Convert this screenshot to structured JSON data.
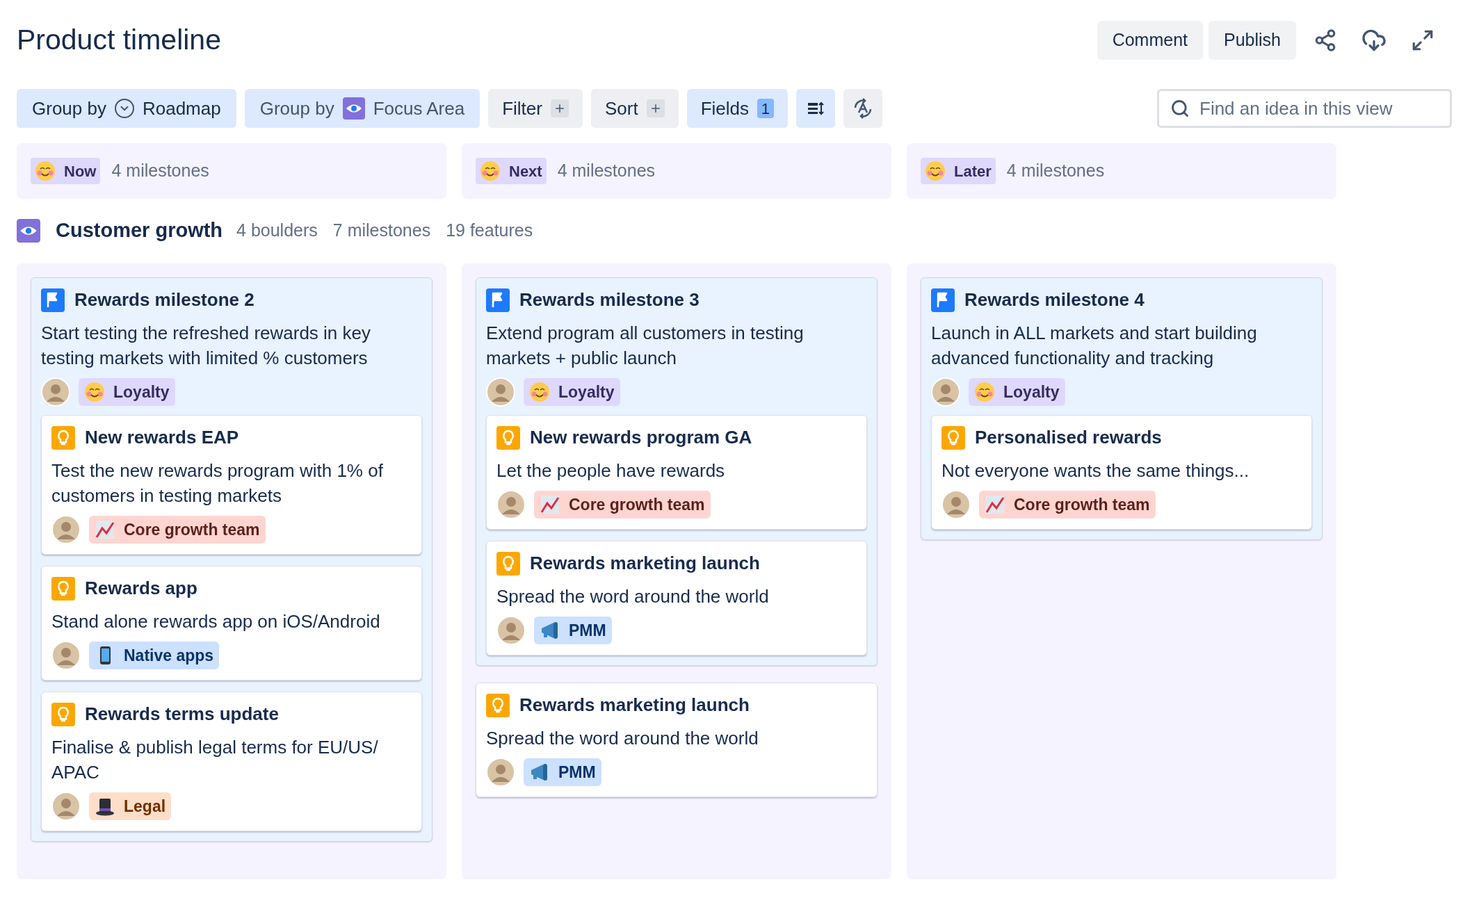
{
  "title": "Product timeline",
  "actions": [
    {
      "label": "Comment"
    },
    {
      "label": "Publish"
    }
  ],
  "toolbar": [
    {
      "kind": "grouping",
      "label": "Group by",
      "value": "Roadmap",
      "active": true
    },
    {
      "kind": "focus",
      "label": "Group by",
      "value": "Focus Area",
      "active": true
    },
    {
      "kind": "add",
      "label": "Filter",
      "active": false
    },
    {
      "kind": "add",
      "label": "Sort",
      "active": false
    },
    {
      "kind": "count",
      "label": "Fields",
      "count": "1",
      "active": true
    },
    {
      "kind": "rows",
      "active": true
    },
    {
      "kind": "rotate",
      "active": false
    }
  ],
  "search": {
    "placeholder": "Find an idea in this view"
  },
  "column_headers": [
    {
      "label": "Now",
      "count": "4 milestones"
    },
    {
      "label": "Next",
      "count": "4 milestones"
    },
    {
      "label": "Later",
      "count": "4 milestones"
    }
  ],
  "group": {
    "title": "Customer growth",
    "stats": [
      "4 boulders",
      "7 milestones",
      "19 features"
    ]
  },
  "columns": [
    {
      "items": [
        {
          "kind": "milestone",
          "title": "Rewards milestone 2",
          "description": "Start testing the refreshed rewards in key testing markets with limited % customers",
          "tags": [
            {
              "kind": "smile",
              "label": "Loyalty",
              "color": "#dfd8fd"
            }
          ],
          "features": [
            {
              "title": "New rewards EAP",
              "description": "Test the new rewards program with 1% of customers in testing markets",
              "tags": [
                {
                  "kind": "chart",
                  "label": "Core growth team",
                  "color": "#ffd5d2"
                }
              ]
            },
            {
              "title": "Rewards app",
              "description": "Stand alone rewards app on iOS/Android",
              "tags": [
                {
                  "kind": "phone",
                  "label": "Native apps",
                  "color": "#cce0ff"
                }
              ]
            },
            {
              "title": "Rewards terms update",
              "description": "Finalise & publish legal terms for EU/US/ APAC",
              "tags": [
                {
                  "kind": "hat",
                  "label": "Legal",
                  "color": "#fedec8"
                }
              ]
            }
          ]
        }
      ]
    },
    {
      "items": [
        {
          "kind": "milestone",
          "title": "Rewards milestone 3",
          "description": "Extend program all customers in testing markets + public launch",
          "tags": [
            {
              "kind": "smile",
              "label": "Loyalty",
              "color": "#dfd8fd"
            }
          ],
          "features": [
            {
              "title": "New rewards program GA",
              "description": "Let the people have rewards",
              "tags": [
                {
                  "kind": "chart",
                  "label": "Core growth team",
                  "color": "#ffd5d2"
                }
              ]
            },
            {
              "title": "Rewards marketing launch",
              "description": "Spread the word around the world",
              "tags": [
                {
                  "kind": "megaphone",
                  "label": "PMM",
                  "color": "#cce0ff"
                }
              ]
            }
          ]
        },
        {
          "kind": "feature",
          "title": "Rewards marketing launch",
          "description": "Spread the word around the world",
          "tags": [
            {
              "kind": "megaphone",
              "label": "PMM",
              "color": "#cce0ff"
            }
          ]
        }
      ]
    },
    {
      "items": [
        {
          "kind": "milestone",
          "title": "Rewards milestone 4",
          "description": "Launch in ALL markets and start building advanced functionality and tracking",
          "tags": [
            {
              "kind": "smile",
              "label": "Loyalty",
              "color": "#dfd8fd"
            }
          ],
          "features": [
            {
              "title": "Personalised rewards",
              "description": "Not everyone wants the same things...",
              "tags": [
                {
                  "kind": "chart",
                  "label": "Core growth team",
                  "color": "#ffd5d2"
                }
              ]
            }
          ]
        }
      ]
    }
  ]
}
